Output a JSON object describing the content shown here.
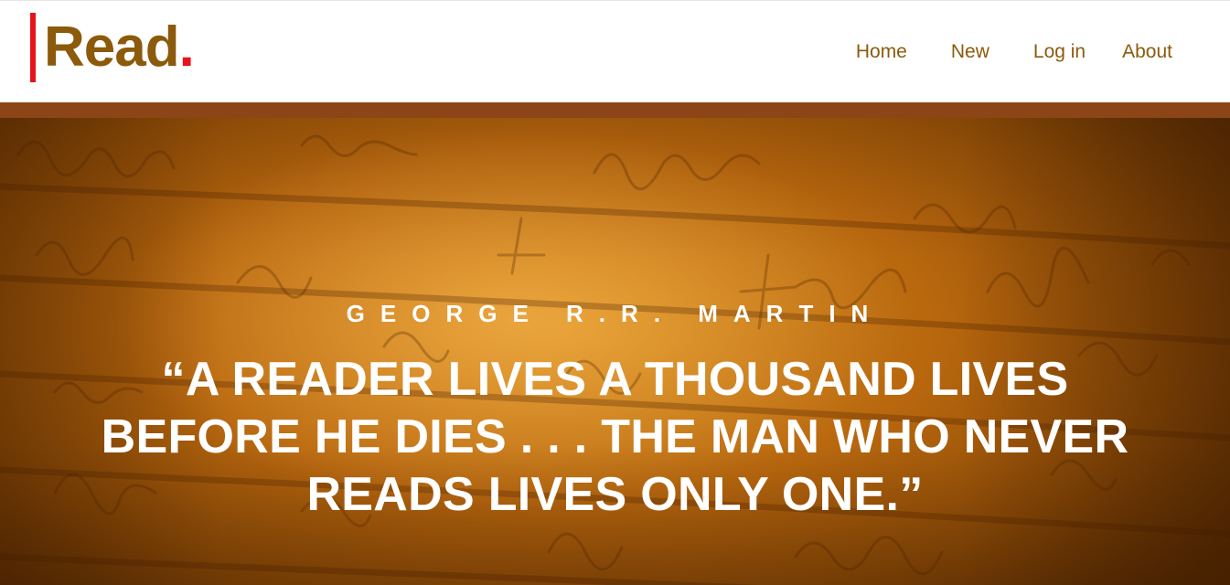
{
  "header": {
    "logo_text": "Read",
    "logo_dot": ".",
    "nav": [
      {
        "label": "Home"
      },
      {
        "label": "New"
      },
      {
        "label": "Log in"
      },
      {
        "label": "About"
      }
    ]
  },
  "hero": {
    "author": "GEORGE R.R. MARTIN",
    "quote": "“A READER LIVES A THOUSAND LIVES BEFORE HE DIES . . . THE MAN WHO NEVER READS LIVES ONLY ONE.”"
  },
  "colors": {
    "brand_brown": "#8c5a0b",
    "accent_red": "#e8141c",
    "strip": "#8c4516",
    "hero_text": "#ffffff"
  }
}
